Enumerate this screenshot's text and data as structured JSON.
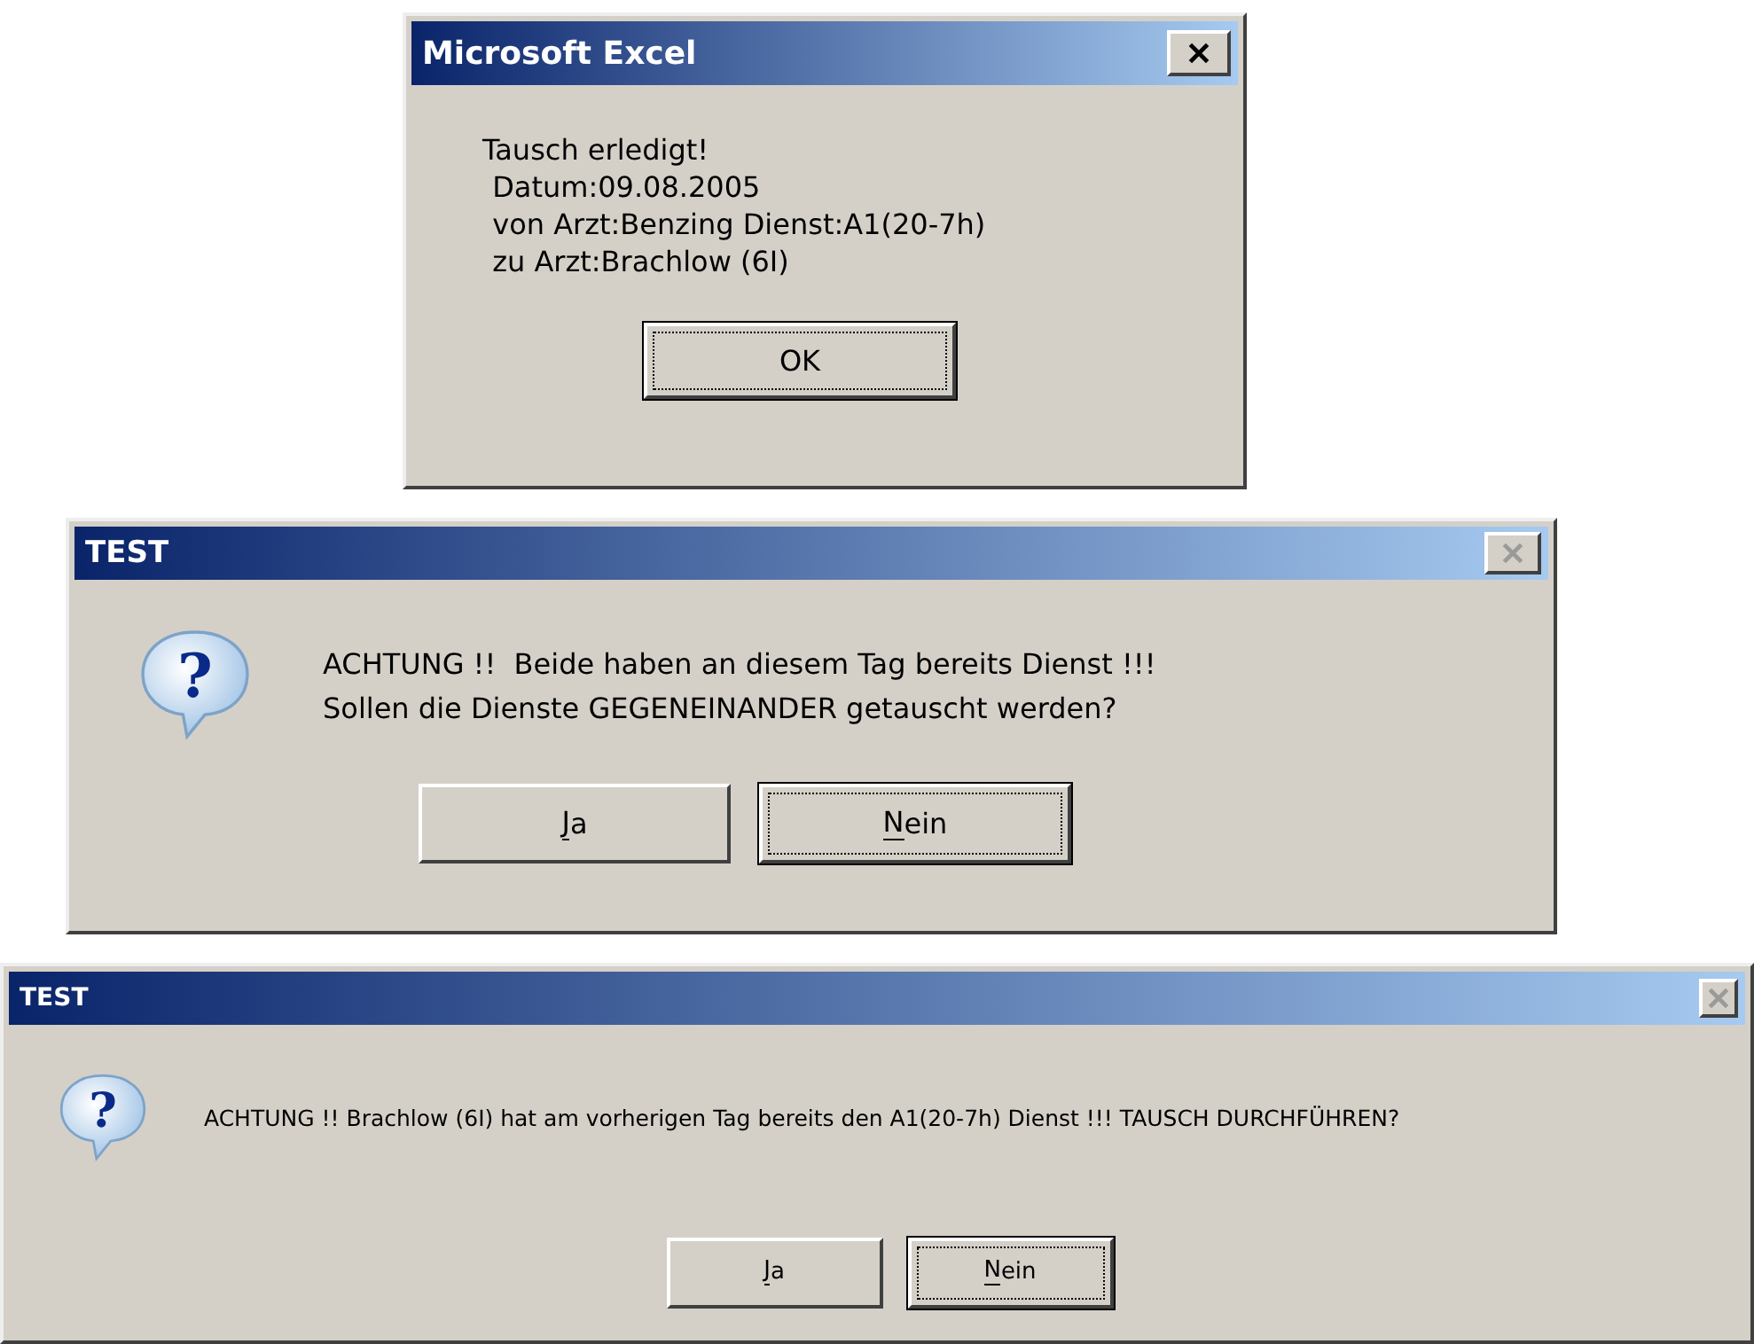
{
  "dialogs": [
    {
      "title": "Microsoft Excel",
      "close_disabled": false,
      "kind": "notice",
      "message": [
        "Tausch erledigt!",
        "Datum:09.08.2005",
        "von Arzt:Benzing Dienst:A1(20-7h)",
        "zu Arzt:Brachlow (6I)"
      ],
      "buttons": [
        {
          "label": "OK",
          "mnemonic": false,
          "default": true
        }
      ]
    },
    {
      "title": "TEST",
      "close_disabled": true,
      "kind": "question",
      "icon_glyph": "?",
      "message": [
        "ACHTUNG !!  Beide haben an diesem Tag bereits Dienst !!!",
        "Sollen die Dienste GEGENEINANDER getauscht werden?"
      ],
      "buttons": [
        {
          "label": "Ja",
          "mnemonic": true,
          "default": false
        },
        {
          "label": "Nein",
          "mnemonic": true,
          "default": true
        }
      ]
    },
    {
      "title": "TEST",
      "close_disabled": true,
      "kind": "question",
      "icon_glyph": "?",
      "message": [
        "ACHTUNG !! Brachlow (6I) hat am vorherigen Tag bereits den A1(20-7h) Dienst !!! TAUSCH DURCHFÜHREN?"
      ],
      "buttons": [
        {
          "label": "Ja",
          "mnemonic": true,
          "default": false
        },
        {
          "label": "Nein",
          "mnemonic": true,
          "default": true
        }
      ]
    }
  ]
}
